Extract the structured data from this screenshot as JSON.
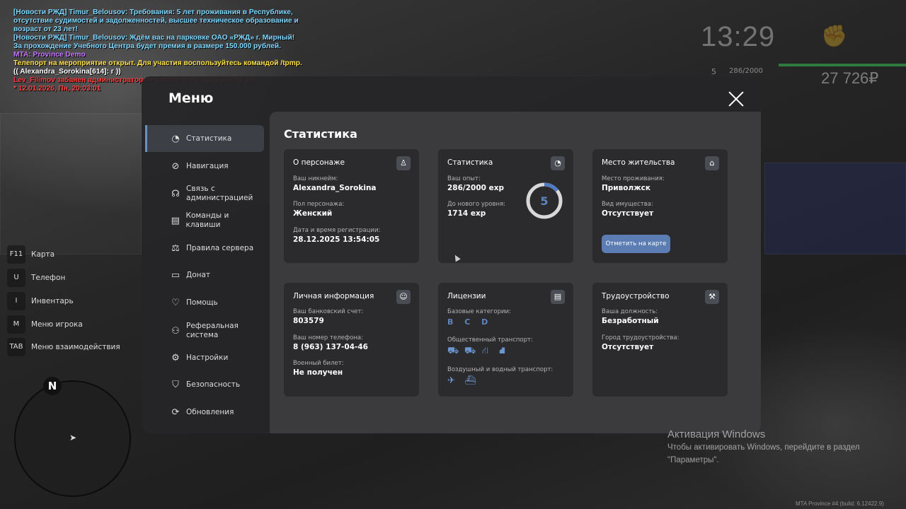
{
  "chat": [
    {
      "text": "[Новости РЖД] Timur_Belousov: Требования: 5 лет проживания в Республике,",
      "color": "#7fd7ff"
    },
    {
      "text": "отсутствие судимостей и задолженностей, высшее техническое образование и",
      "color": "#7fd7ff"
    },
    {
      "text": " возраст от 23 лет!",
      "color": "#7fd7ff"
    },
    {
      "text": "[Новости РЖД] Timur_Belousov: Ждём вас на парковке ОАО «РЖД» г. Мирный!",
      "color": "#7fd7ff"
    },
    {
      "text": " За прохождение Учебного Центра будет премия в размере 150.000 рублей.",
      "color": "#7fd7ff"
    },
    {
      "text": "MTA: Province Demo",
      "color": "#c678ff"
    },
    {
      "text": "Телепорт на мероприятие открыт. Для участия воспользуйтесь командой /tpmp.",
      "color": "#ffe14a"
    },
    {
      "text": "(( Alexandra_Sorokina[614]: г ))",
      "color": "#ffffff"
    },
    {
      "text": "Lev_Filimov забанен администратором Saburo_lite (1 дн.) (DB by SI)",
      "color": "#ff3b3b"
    },
    {
      "text": "* 12.01.2026, Пн, 20:03:01",
      "color": "#ff4040"
    }
  ],
  "hud": {
    "clock": "13:29",
    "level": "5",
    "xp": "286/2000",
    "money": "27 726₽"
  },
  "menu": {
    "title": "Меню"
  },
  "nav": [
    {
      "label": "Статистика",
      "icon": "◔",
      "name": "stats"
    },
    {
      "label": "Навигация",
      "icon": "⊘",
      "name": "navigation"
    },
    {
      "label": "Связь с администрацией",
      "icon": "☊",
      "name": "contact-admin"
    },
    {
      "label": "Команды и клавиши",
      "icon": "▤",
      "name": "commands-keys"
    },
    {
      "label": "Правила сервера",
      "icon": "⚖",
      "name": "server-rules"
    },
    {
      "label": "Донат",
      "icon": "▭",
      "name": "donate"
    },
    {
      "label": "Помощь",
      "icon": "♡",
      "name": "help"
    },
    {
      "label": "Реферальная система",
      "icon": "⚇",
      "name": "referral"
    },
    {
      "label": "Настройки",
      "icon": "⚙",
      "name": "settings"
    },
    {
      "label": "Безопасность",
      "icon": "⛉",
      "name": "security"
    },
    {
      "label": "Обновления",
      "icon": "⟳",
      "name": "updates"
    }
  ],
  "content": {
    "title": "Статистика",
    "character": {
      "title": "О персонаже",
      "nick_label": "Ваш никнейм:",
      "nick": "Alexandra_Sorokina",
      "gender_label": "Пол персонажа:",
      "gender": "Женский",
      "reg_label": "Дата и время регистрации:",
      "reg": "28.12.2025 13:54:05"
    },
    "stats": {
      "title": "Статистика",
      "exp_label": "Ваш опыт:",
      "exp": "286/2000 exp",
      "next_label": "До нового уровня:",
      "next": "1714 exp",
      "level": "5",
      "progress": 0.143
    },
    "residence": {
      "title": "Место жительства",
      "place_label": "Место проживания:",
      "place": "Приволжск",
      "property_label": "Вид имущества:",
      "property": "Отсутствует",
      "button": "Отметить на карте"
    },
    "personal": {
      "title": "Личная информация",
      "bank_label": "Ваш банковский счет:",
      "bank": "803579",
      "phone_label": "Ваш номер телефона:",
      "phone": "8 (963) 137-04-46",
      "military_label": "Военный билет:",
      "military": "Не получен"
    },
    "licenses": {
      "title": "Лицензии",
      "base_label": "Базовые категории:",
      "base": "B C D",
      "public_label": "Общественный транспорт:",
      "air_label": "Воздушный и водный транспорт:"
    },
    "employment": {
      "title": "Трудоустройство",
      "position_label": "Ваша должность:",
      "position": "Безработный",
      "city_label": "Город трудоустройства:",
      "city": "Отсутствует"
    }
  },
  "hotkeys": [
    {
      "key": "F11",
      "label": "Карта"
    },
    {
      "key": "U",
      "label": "Телефон"
    },
    {
      "key": "I",
      "label": "Инвентарь"
    },
    {
      "key": "M",
      "label": "Меню игрока"
    },
    {
      "key": "TAB",
      "label": "Меню взаимодействия"
    }
  ],
  "radar": {
    "north": "N"
  },
  "windows": {
    "title": "Активация Windows",
    "line1": "Чтобы активировать Windows, перейдите в раздел",
    "line2": "\"Параметры\"."
  },
  "build": "MTA Province #4 (build: 6.12422.9)"
}
